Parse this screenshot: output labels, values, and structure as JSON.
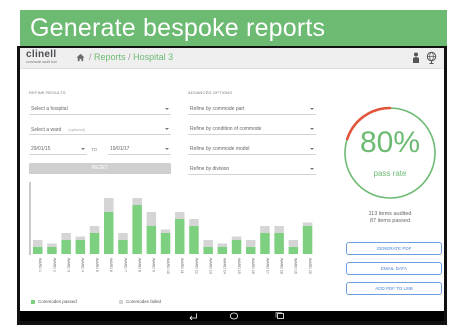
{
  "banner": {
    "title": "Generate bespoke reports"
  },
  "app": {
    "logo": "clinell",
    "logo_sub": "commode audit tool",
    "breadcrumb": {
      "sep1": "/",
      "reports": "Reports",
      "sep2": "/",
      "current": "Hospital 3"
    }
  },
  "filters": {
    "refine_label": "REFINE RESULTS",
    "hospital_placeholder": "Select a hospital",
    "ward_placeholder": "Select a ward",
    "ward_optional": "(optional)",
    "date_from": "29/01/15",
    "date_to_label": "TO",
    "date_to": "19/01/17",
    "reset_label": "RESET"
  },
  "advanced": {
    "label": "ADVANCED OPTIONS",
    "part": "Refine by commode part",
    "condition": "Refine by condition of commode",
    "model": "Refine by commode model",
    "division": "Refine by division"
  },
  "summary": {
    "percent": "80%",
    "percent_value": 80,
    "subtitle": "pass rate",
    "audited": "113 items audited",
    "passed": "87 items passed"
  },
  "actions": {
    "generate": "GENERATE PDF",
    "email": "EMAIL DATA",
    "add": "ADD PDF TO USB"
  },
  "chart_data": {
    "type": "bar",
    "stacked": true,
    "categories": [
      "WARD 1",
      "WARD 2",
      "WARD 3",
      "WARD 4",
      "WARD 5",
      "WARD 6",
      "WARD 7",
      "WARD 8",
      "WARD 9",
      "WARD 10",
      "WARD 11",
      "WARD 12",
      "WARD 13",
      "WARD 14",
      "WARD 15",
      "WARD 16",
      "WARD 17",
      "WARD 18",
      "WARD 19",
      "WARD 20"
    ],
    "series": [
      {
        "name": "Commodes passed",
        "color": "#7dd07f",
        "values": [
          1,
          1,
          2,
          2,
          3,
          6,
          2,
          7,
          4,
          3,
          5,
          4,
          1,
          1,
          2,
          1,
          3,
          3,
          1,
          4
        ]
      },
      {
        "name": "Commodes failed",
        "color": "#d5d5d5",
        "values": [
          1,
          0.5,
          1,
          0.5,
          1,
          2,
          1,
          1,
          2,
          0.5,
          1,
          1,
          1,
          0.5,
          0.5,
          1,
          1,
          1,
          1,
          0.5
        ]
      }
    ],
    "ylim": [
      0,
      10
    ]
  },
  "legend": {
    "passed": "Commodes passed",
    "failed": "Commodes failed"
  },
  "colors": {
    "brand": "#6dba73",
    "accent_blue": "#4b7fd1",
    "gauge_red": "#e2553a"
  }
}
